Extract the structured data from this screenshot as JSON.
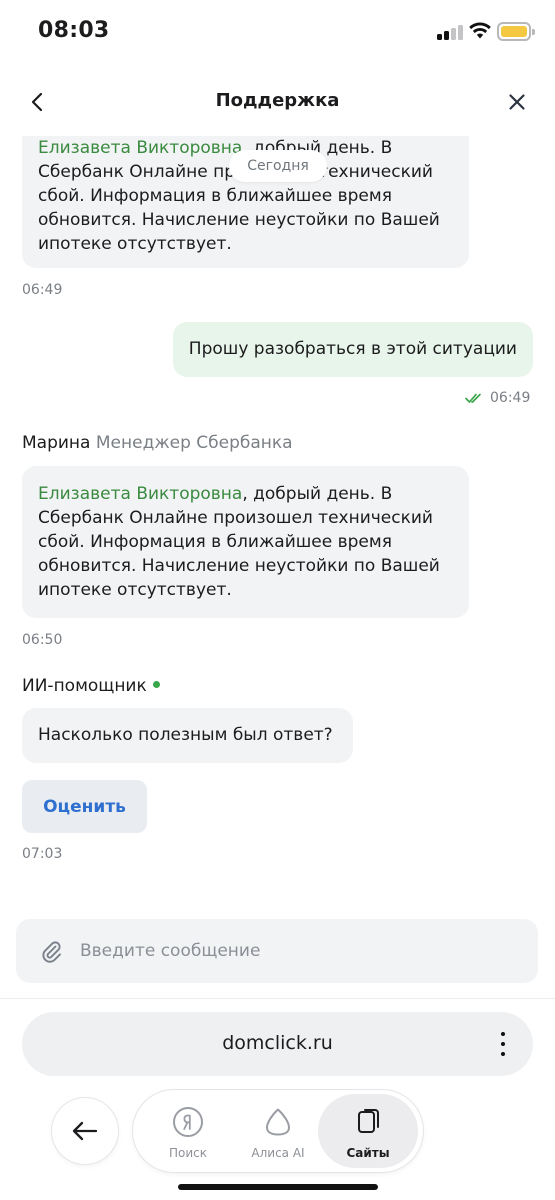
{
  "status_bar": {
    "time": "08:03"
  },
  "header": {
    "title": "Поддержка"
  },
  "chat": {
    "date_separator": "Сегодня",
    "messages": [
      {
        "name_highlight": "Елизавета Викторовна",
        "text": ", добрый день. В Сбербанк Онлайне произошел технический сбой. Информация в ближайшее время обновится. Начисление неустойки по Вашей ипотеке отсутствует.",
        "time": "06:49"
      },
      {
        "text": "Прошу разобраться в этой ситуации",
        "time": "06:49",
        "status": "read"
      },
      {
        "sender": "Марина",
        "sender_role": "Менеджер Сбербанка",
        "name_highlight": "Елизавета Викторовна",
        "text": ", добрый день. В Сбербанк Онлайне произошел технический сбой. Информация в ближайшее время обновится. Начисление неустойки по Вашей ипотеке отсутствует.",
        "time": "06:50"
      },
      {
        "sender": "ИИ-помощник",
        "text": "Насколько полезным был ответ?",
        "action_label": "Оценить",
        "time": "07:03"
      }
    ]
  },
  "composer": {
    "placeholder": "Введите сообщение"
  },
  "browser": {
    "url": "domclick.ru",
    "nav": [
      {
        "label": "Поиск",
        "icon": "yandex-icon"
      },
      {
        "label": "Алиса AI",
        "icon": "alice-icon"
      },
      {
        "label": "Сайты",
        "icon": "sites-icon",
        "active": true
      }
    ]
  },
  "colors": {
    "accent_green": "#3a8a3f",
    "link_blue": "#2f6fcf",
    "battery": "#f5c842"
  }
}
